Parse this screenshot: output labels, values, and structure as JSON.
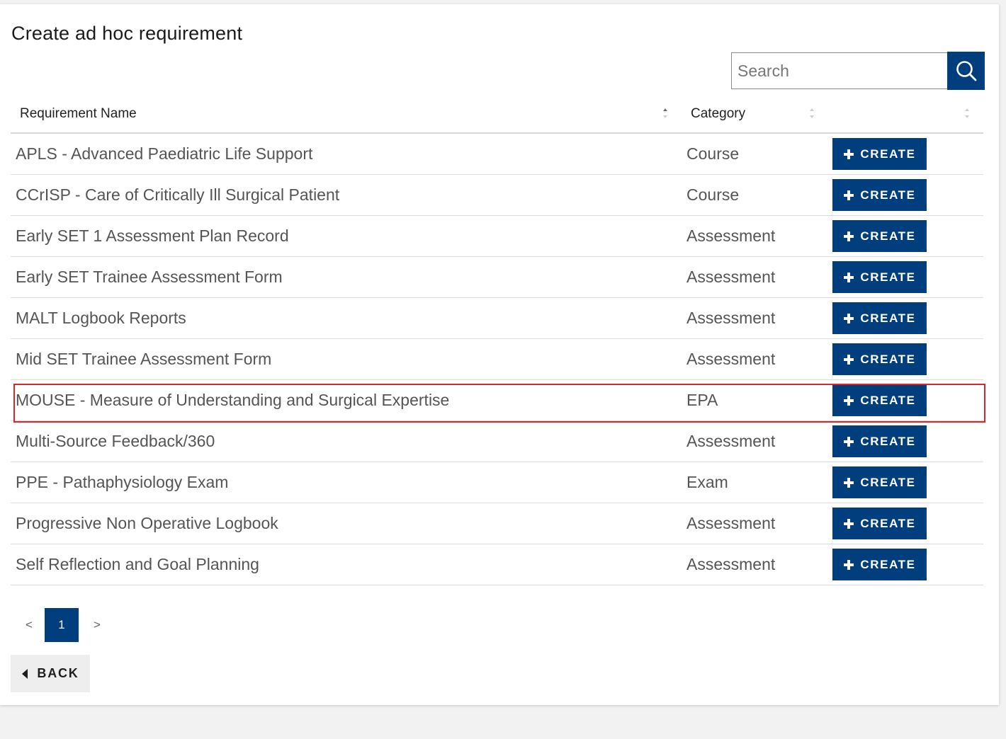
{
  "page": {
    "title": "Create ad hoc requirement"
  },
  "search": {
    "placeholder": "Search",
    "value": ""
  },
  "table": {
    "columns": [
      "Requirement Name",
      "Category",
      ""
    ],
    "create_label": "CREATE",
    "rows": [
      {
        "name": "APLS - Advanced Paediatric Life Support",
        "category": "Course"
      },
      {
        "name": "CCrISP - Care of Critically Ill Surgical Patient",
        "category": "Course"
      },
      {
        "name": "Early SET 1 Assessment Plan Record",
        "category": "Assessment"
      },
      {
        "name": "Early SET Trainee Assessment Form",
        "category": "Assessment"
      },
      {
        "name": "MALT Logbook Reports",
        "category": "Assessment"
      },
      {
        "name": "Mid SET Trainee Assessment Form",
        "category": "Assessment"
      },
      {
        "name": "MOUSE - Measure of Understanding and Surgical Expertise",
        "category": "EPA",
        "highlighted": true
      },
      {
        "name": "Multi-Source Feedback/360",
        "category": "Assessment"
      },
      {
        "name": "PPE - Pathaphysiology Exam",
        "category": "Exam"
      },
      {
        "name": "Progressive Non Operative Logbook",
        "category": "Assessment"
      },
      {
        "name": "Self Reflection and Goal Planning",
        "category": "Assessment"
      }
    ]
  },
  "pagination": {
    "prev": "<",
    "current": "1",
    "next": ">"
  },
  "back": {
    "label": "BACK"
  },
  "colors": {
    "accent": "#003e7e",
    "highlight": "#d6262e"
  },
  "icons": {
    "search": "search-icon",
    "create": "plus-icon",
    "back": "caret-left-icon",
    "sort": "sort-icon"
  }
}
